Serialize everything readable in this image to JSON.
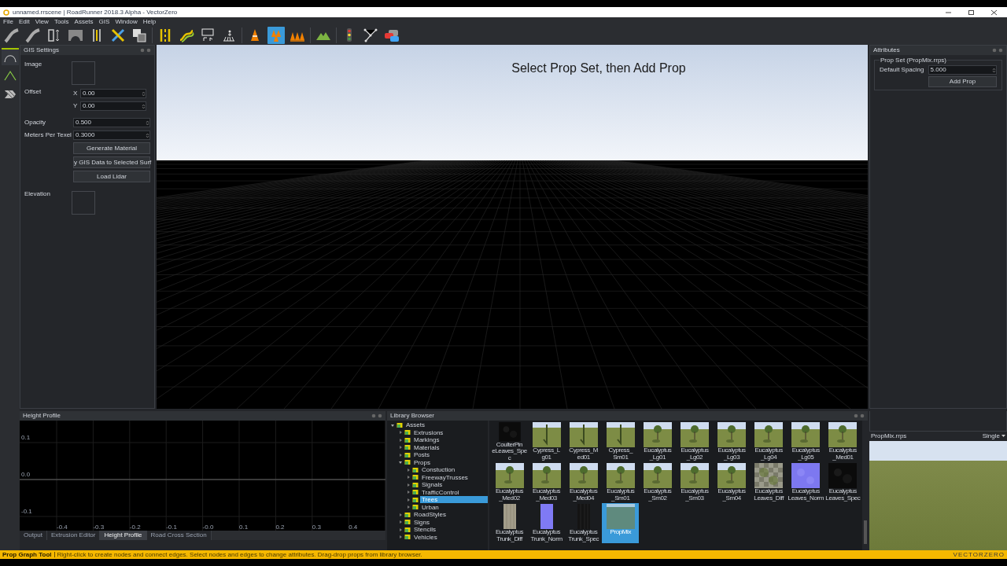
{
  "window": {
    "title": "unnamed.rrscene | RoadRunner 2018.3 Alpha - VectorZero"
  },
  "menu": [
    "File",
    "Edit",
    "View",
    "Tools",
    "Assets",
    "GIS",
    "Window",
    "Help"
  ],
  "toolbar": [
    {
      "kind": "road",
      "selected": false
    },
    {
      "kind": "road",
      "selected": false
    },
    {
      "kind": "ruler",
      "selected": false
    },
    {
      "kind": "bridge",
      "selected": false
    },
    {
      "kind": "lane",
      "selected": false
    },
    {
      "kind": "cross",
      "selected": false
    },
    {
      "kind": "layers",
      "selected": false
    },
    {
      "kind": "lanes",
      "selected": false
    },
    {
      "kind": "curve",
      "selected": false
    },
    {
      "kind": "speed",
      "selected": false
    },
    {
      "kind": "crosswalk",
      "selected": false
    },
    {
      "kind": "cone",
      "selected": false
    },
    {
      "kind": "cones",
      "selected": true
    },
    {
      "kind": "conerow",
      "selected": false
    },
    {
      "kind": "mountain",
      "selected": false
    },
    {
      "kind": "light",
      "selected": false
    },
    {
      "kind": "graph",
      "selected": false
    },
    {
      "kind": "cars",
      "selected": false
    }
  ],
  "side_tools": [
    {
      "kind": "arc",
      "selected": true
    },
    {
      "kind": "angle",
      "selected": false
    },
    {
      "kind": "hatch",
      "selected": false
    }
  ],
  "gis_settings": {
    "title": "GIS Settings",
    "image_label": "Image",
    "offset_label": "Offset",
    "x_label": "X",
    "x_value": "0.00",
    "y_label": "Y",
    "y_value": "0.00",
    "opacity_label": "Opacity",
    "opacity_value": "0.500",
    "mpt_label": "Meters Per Texel",
    "mpt_value": "0.3000",
    "buttons": [
      "Generate Material",
      "y GIS Data to Selected Surf",
      "Load Lidar"
    ],
    "elevation_label": "Elevation"
  },
  "viewport": {
    "hint": "Select Prop Set, then Add Prop"
  },
  "attributes": {
    "title": "Attributes",
    "group": "Prop Set (PropMix.rrps)",
    "spacing_label": "Default Spacing",
    "spacing_value": "5.000",
    "button": "Add Prop"
  },
  "height_profile": {
    "title": "Height Profile",
    "y_labels": [
      "0.1",
      "0.0",
      "-0.1"
    ],
    "x_labels": [
      "-0.4",
      "-0.3",
      "-0.2",
      "-0.1",
      "-0.0",
      "0.1",
      "0.2",
      "0.3",
      "0.4"
    ]
  },
  "bottom_tabs": [
    {
      "label": "Output",
      "selected": false
    },
    {
      "label": "Extrusion Editor",
      "selected": false
    },
    {
      "label": "Height Profile",
      "selected": true
    },
    {
      "label": "Road Cross Section",
      "selected": false
    }
  ],
  "library": {
    "title": "Library Browser",
    "tree": [
      {
        "label": "Assets",
        "expanded": true,
        "selected": false,
        "children": [
          {
            "label": "Extrusions",
            "expanded": false,
            "selected": false
          },
          {
            "label": "Markings",
            "expanded": false,
            "selected": false
          },
          {
            "label": "Materials",
            "expanded": false,
            "selected": false
          },
          {
            "label": "Posts",
            "expanded": false,
            "selected": false
          },
          {
            "label": "Props",
            "expanded": true,
            "selected": false,
            "children": [
              {
                "label": "Constuction",
                "expanded": false,
                "selected": false
              },
              {
                "label": "FreewayTrusses",
                "expanded": false,
                "selected": false
              },
              {
                "label": "Signals",
                "expanded": false,
                "selected": false
              },
              {
                "label": "TrafficControl",
                "expanded": false,
                "selected": false
              },
              {
                "label": "Trees",
                "expanded": false,
                "selected": true
              },
              {
                "label": "Urban",
                "expanded": false,
                "selected": false
              }
            ]
          },
          {
            "label": "RoadStyles",
            "expanded": false,
            "selected": false
          },
          {
            "label": "Signs",
            "expanded": false,
            "selected": false
          },
          {
            "label": "Stencils",
            "expanded": false,
            "selected": false
          },
          {
            "label": "Vehicles",
            "expanded": false,
            "selected": false
          }
        ]
      }
    ],
    "assets": [
      {
        "label": "CoulterPin eLeaves_Spec",
        "kind": "dark",
        "selected": false
      },
      {
        "label": "Cypress_L g01",
        "kind": "cypress",
        "selected": false
      },
      {
        "label": "Cypress_M ed01",
        "kind": "cypress",
        "selected": false
      },
      {
        "label": "Cypress_ Sm01",
        "kind": "cypress",
        "selected": false
      },
      {
        "label": "Eucalyptus _Lg01",
        "kind": "tree",
        "selected": false
      },
      {
        "label": "Eucalyptus _Lg02",
        "kind": "tree",
        "selected": false
      },
      {
        "label": "Eucalyptus _Lg03",
        "kind": "tree",
        "selected": false
      },
      {
        "label": "Eucalyptus _Lg04",
        "kind": "tree",
        "selected": false
      },
      {
        "label": "Eucalyptus _Lg05",
        "kind": "tree",
        "selected": false
      },
      {
        "label": "Eucalyptus _Med01",
        "kind": "tree",
        "selected": false
      },
      {
        "label": "Eucalyptus _Med02",
        "kind": "tree",
        "selected": false
      },
      {
        "label": "Eucalyptus _Med03",
        "kind": "tree",
        "selected": false
      },
      {
        "label": "Eucalyptus _Med04",
        "kind": "tree",
        "selected": false
      },
      {
        "label": "Eucalyptus _Sm01",
        "kind": "tree",
        "selected": false
      },
      {
        "label": "Eucalyptus _Sm02",
        "kind": "tree",
        "selected": false
      },
      {
        "label": "Eucalyptus _Sm03",
        "kind": "tree",
        "selected": false
      },
      {
        "label": "Eucalyptus _Sm04",
        "kind": "tree",
        "selected": false
      },
      {
        "label": "Eucalyptus Leaves_Diff",
        "kind": "checker",
        "selected": false
      },
      {
        "label": "Eucalyptus Leaves_Norm",
        "kind": "normal",
        "selected": false
      },
      {
        "label": "Eucalyptus Leaves_Spec",
        "kind": "dark",
        "selected": false
      },
      {
        "label": "Eucalyptus Trunk_Diff",
        "kind": "bark",
        "selected": false
      },
      {
        "label": "Eucalyptus Trunk_Norm",
        "kind": "normalbar",
        "selected": false
      },
      {
        "label": "Eucalyptus Trunk_Spec",
        "kind": "barkdark",
        "selected": false
      },
      {
        "label": "PropMix",
        "kind": "mix",
        "selected": true
      }
    ]
  },
  "preview": {
    "title": "PropMix.rrps",
    "mode": "Single"
  },
  "status_bar": {
    "tool": "Prop Graph Tool",
    "message": "Right-click to create nodes and connect edges. Select nodes and edges to change attributes. Drag-drop props from library browser.",
    "brand": "VECTORZERO"
  }
}
